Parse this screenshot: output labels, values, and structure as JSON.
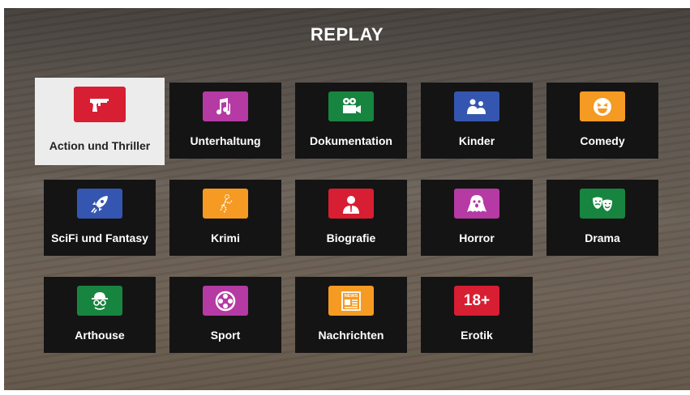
{
  "header": {
    "title": "REPLAY"
  },
  "categories": [
    {
      "label": "Action und Thriller",
      "icon": "pistol-icon",
      "color": "#d81e32",
      "selected": true
    },
    {
      "label": "Unterhaltung",
      "icon": "music-notes-icon",
      "color": "#b53aa3"
    },
    {
      "label": "Dokumentation",
      "icon": "film-camera-icon",
      "color": "#17853f"
    },
    {
      "label": "Kinder",
      "icon": "family-icon",
      "color": "#3556b0"
    },
    {
      "label": "Comedy",
      "icon": "laughing-face-icon",
      "color": "#f59a22"
    },
    {
      "label": "SciFi und Fantasy",
      "icon": "rocket-icon",
      "color": "#3556b0"
    },
    {
      "label": "Krimi",
      "icon": "chalk-outline-icon",
      "color": "#f59a22"
    },
    {
      "label": "Biografie",
      "icon": "person-portrait-icon",
      "color": "#d81e32"
    },
    {
      "label": "Horror",
      "icon": "ghost-icon",
      "color": "#b53aa3"
    },
    {
      "label": "Drama",
      "icon": "theater-masks-icon",
      "color": "#17853f"
    },
    {
      "label": "Arthouse",
      "icon": "hat-glasses-icon",
      "color": "#17853f"
    },
    {
      "label": "Sport",
      "icon": "film-reel-icon",
      "color": "#b53aa3"
    },
    {
      "label": "Nachrichten",
      "icon": "newspaper-icon",
      "color": "#f59a22",
      "icon_text": "NEWS"
    },
    {
      "label": "Erotik",
      "icon": "eighteen-plus-icon",
      "color": "#d81e32",
      "icon_text": "18+"
    }
  ]
}
